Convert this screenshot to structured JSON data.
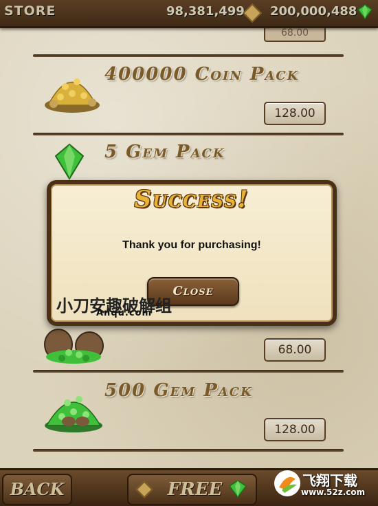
{
  "header": {
    "title": "STORE",
    "coins": "98,381,499",
    "gems": "200,000,488"
  },
  "store": {
    "partial_price_top": "68.00",
    "items": [
      {
        "name": "400000 Coin Pack",
        "price": "128.00"
      },
      {
        "name": "5 Gem Pack",
        "price": ""
      },
      {
        "name": "",
        "price": "68.00"
      },
      {
        "name": "500 Gem Pack",
        "price": "128.00"
      }
    ]
  },
  "dialog": {
    "title": "Success!",
    "message": "Thank you for purchasing!",
    "close_label": "Close"
  },
  "bottom": {
    "back_label": "BACK",
    "free_label": "FREE"
  },
  "watermarks": {
    "left": "小刀安趣破解组",
    "left_sub": "Anqu.com",
    "right": "飞翔下载",
    "right_sub": "www.52z.com"
  },
  "colors": {
    "brown_dark": "#3f2a16",
    "gold_title": "#e8b336",
    "gem_green": "#3fbf3a",
    "parchment": "#dcd3bb"
  }
}
